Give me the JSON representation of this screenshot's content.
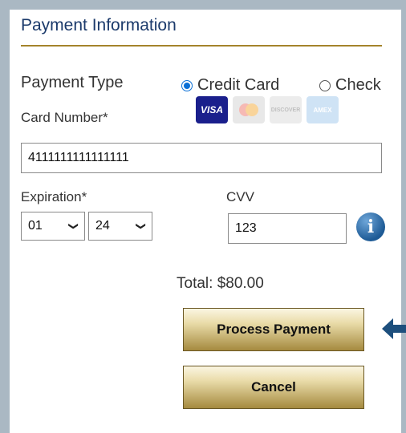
{
  "payment": {
    "title": "Payment Information",
    "payment_type_label": "Payment Type",
    "options": [
      {
        "label": "Credit Card",
        "selected": true
      },
      {
        "label": "Check",
        "selected": false
      }
    ],
    "card_number_label": "Card Number*",
    "card_logos": [
      {
        "name": "visa-logo",
        "text": "VISA"
      },
      {
        "name": "mastercard-logo",
        "text": ""
      },
      {
        "name": "discover-logo",
        "text": "DISCOVER"
      },
      {
        "name": "amex-logo",
        "text": "AMEX"
      }
    ],
    "card_number_value": "4111111111111111",
    "expiration_label": "Expiration*",
    "exp_month": "01",
    "exp_year": "24",
    "cvv_label": "CVV",
    "cvv_value": "123",
    "total_text": "Total: $80.00",
    "process_button": "Process Payment",
    "cancel_button": "Cancel"
  },
  "colors": {
    "title": "#1b3a6b",
    "rule": "#a4832b",
    "radio_selected": "#0a6fd6",
    "arrow": "#1d4f7d"
  },
  "icons": [
    "info-icon",
    "left-arrow-icon"
  ]
}
